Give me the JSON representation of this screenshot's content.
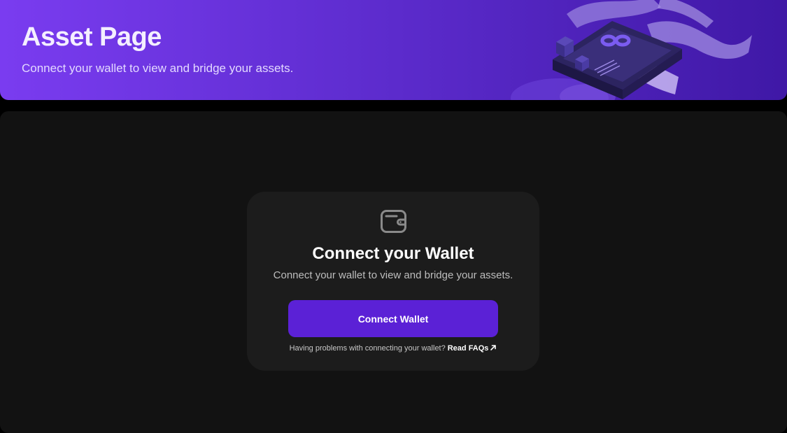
{
  "header": {
    "title": "Asset Page",
    "subtitle": "Connect your wallet to view and bridge your assets.",
    "illustration": "bridge-device-illustration"
  },
  "card": {
    "icon": "wallet-icon",
    "title": "Connect your Wallet",
    "subtitle": "Connect your wallet to view and bridge your assets.",
    "button_label": "Connect Wallet",
    "help_text": "Having problems with connecting your wallet?",
    "faq_link_label": "Read FAQs",
    "faq_link_icon": "external-arrow-icon"
  },
  "colors": {
    "accent": "#5b21d6",
    "header_gradient_start": "#7a3cf0",
    "header_gradient_end": "#3f18a6",
    "page_background": "#000000",
    "panel_background": "#121212",
    "card_background": "#1c1c1c"
  }
}
